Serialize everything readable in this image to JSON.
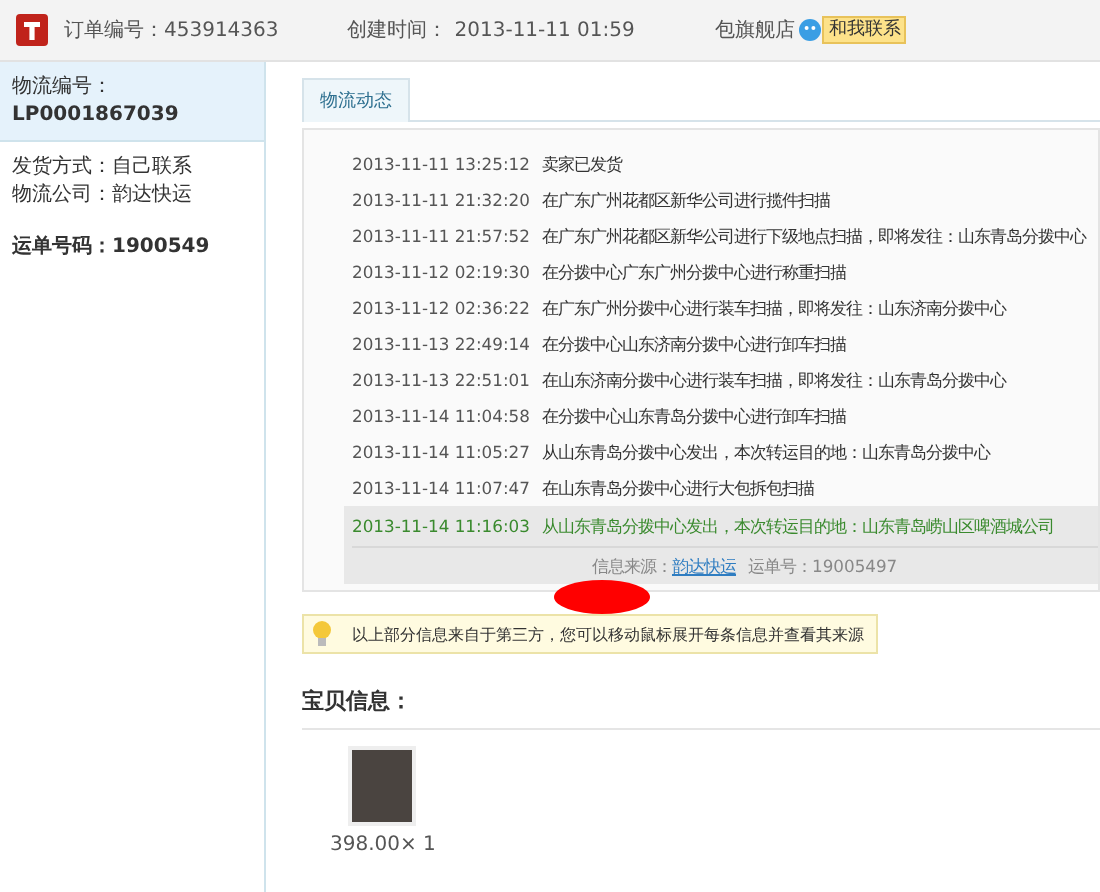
{
  "header": {
    "order_label": "订单编号：",
    "order_number": "453914363",
    "created_label": "创建时间：",
    "created_time": "2013-11-11 01:59",
    "shop": "包旗舰店",
    "contact_button": "和我联系"
  },
  "sidebar": {
    "logistics_label": "物流编号：",
    "logistics_number": "LP0001867039",
    "shipping_method": "发货方式：自己联系",
    "logistics_company": "物流公司：韵达快运",
    "waybill": "运单号码：1900549"
  },
  "tabs": [
    {
      "label": "物流动态",
      "selected": true
    }
  ],
  "events": [
    {
      "time": "2013-11-11 13:25:12",
      "text": "卖家已发货",
      "expanded": false
    },
    {
      "time": "2013-11-11 21:32:20",
      "text": "在广东广州花都区新华公司进行揽件扫描",
      "expanded": false
    },
    {
      "time": "2013-11-11 21:57:52",
      "text": "在广东广州花都区新华公司进行下级地点扫描，即将发往：山东青岛分拨中心",
      "expanded": false
    },
    {
      "time": "2013-11-12 02:19:30",
      "text": "在分拨中心广东广州分拨中心进行称重扫描",
      "expanded": false
    },
    {
      "time": "2013-11-12 02:36:22",
      "text": "在广东广州分拨中心进行装车扫描，即将发往：山东济南分拨中心",
      "expanded": false
    },
    {
      "time": "2013-11-13 22:49:14",
      "text": "在分拨中心山东济南分拨中心进行卸车扫描",
      "expanded": false
    },
    {
      "time": "2013-11-13 22:51:01",
      "text": "在山东济南分拨中心进行装车扫描，即将发往：山东青岛分拨中心",
      "expanded": false
    },
    {
      "time": "2013-11-14 11:04:58",
      "text": "在分拨中心山东青岛分拨中心进行卸车扫描",
      "expanded": false
    },
    {
      "time": "2013-11-14 11:05:27",
      "text": "从山东青岛分拨中心发出，本次转运目的地：山东青岛分拨中心",
      "expanded": false
    },
    {
      "time": "2013-11-14 11:07:47",
      "text": "在山东青岛分拨中心进行大包拆包扫描",
      "expanded": false
    },
    {
      "time": "2013-11-14 11:16:03",
      "text": "从山东青岛分拨中心发出，本次转运目的地：山东青岛崂山区啤酒城公司",
      "expanded": true,
      "source_label": "信息来源：",
      "source_link": "韵达快运",
      "waybill": "运单号：19005497"
    }
  ],
  "tip": "以上部分信息来自于第三方，您可以移动鼠标展开每条信息并查看其来源",
  "items_title": "宝贝信息：",
  "items": [
    {
      "price": "398.00× 1"
    }
  ]
}
